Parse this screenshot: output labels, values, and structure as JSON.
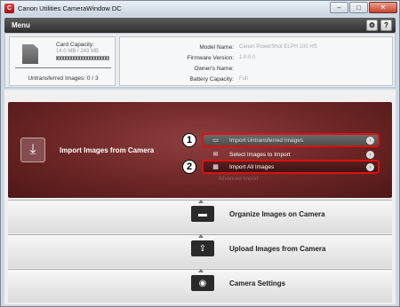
{
  "window": {
    "title": "Canon Utilities CameraWindow DC",
    "app_icon": "C",
    "minimize_glyph": "–",
    "maximize_glyph": "□",
    "close_glyph": "✕"
  },
  "menubar": {
    "menu_label": "Menu",
    "settings_glyph": "⚙",
    "help_glyph": "?"
  },
  "card": {
    "capacity_label": "Card Capacity:",
    "capacity_value": "14.0 MB / 243 MB",
    "untransferred_label": "Untransferred Images: 0 / 3"
  },
  "camera_details": [
    {
      "label": "Model Name:",
      "value": "Canon PowerShot ELPH 100 HS"
    },
    {
      "label": "Firmware Version:",
      "value": "1.0.0.0"
    },
    {
      "label": "Owner's Name:",
      "value": ""
    },
    {
      "label": "Battery Capacity:",
      "value": "Full"
    }
  ],
  "import": {
    "title": "Import Images from Camera",
    "options": [
      {
        "label": "Import Untransferred Images",
        "icon": "monitor-icon"
      },
      {
        "label": "Select Images to Import",
        "icon": "envelope-icon"
      },
      {
        "label": "Import All Images",
        "icon": "grid-icon"
      }
    ],
    "faded_option": "Advanced Import",
    "callouts": [
      "1",
      "2"
    ],
    "highlight_color": "#e01010"
  },
  "sections": [
    {
      "label": "Organize Images on Camera",
      "icon": "folder-icon"
    },
    {
      "label": "Upload Images from Camera",
      "icon": "upload-icon"
    },
    {
      "label": "Camera Settings",
      "icon": "camera-icon"
    }
  ]
}
